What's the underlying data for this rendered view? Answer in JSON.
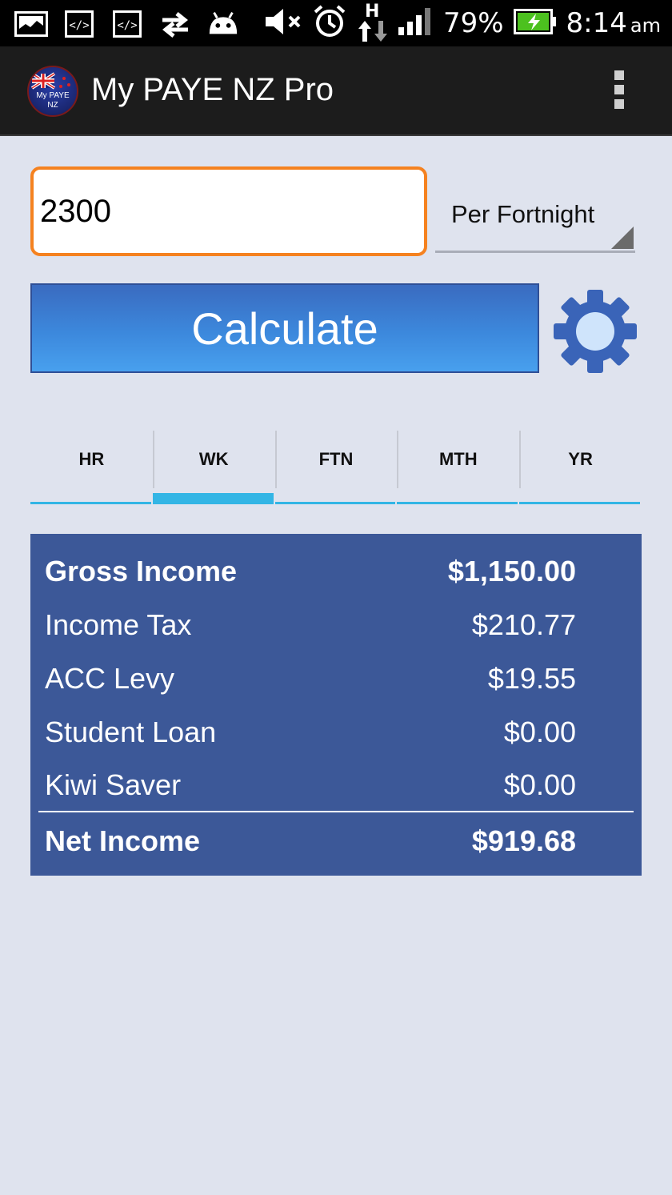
{
  "status_bar": {
    "battery_percent": "79%",
    "time": "8:14",
    "ampm": "am",
    "network_label": "H",
    "icons": [
      "image-icon",
      "code-icon",
      "code-icon",
      "sync-icon",
      "android-icon",
      "mute-icon",
      "alarm-icon",
      "network-h-icon",
      "signal-icon",
      "battery-icon"
    ]
  },
  "action_bar": {
    "title": "My PAYE NZ Pro",
    "logo_text_line1": "My PAYE",
    "logo_text_line2": "NZ"
  },
  "input": {
    "value": "2300"
  },
  "period_select": {
    "selected": "Per Fortnight"
  },
  "calculate_button": {
    "label": "Calculate"
  },
  "tabs": [
    {
      "label": "HR",
      "active": false
    },
    {
      "label": "WK",
      "active": true
    },
    {
      "label": "FTN",
      "active": false
    },
    {
      "label": "MTH",
      "active": false
    },
    {
      "label": "YR",
      "active": false
    }
  ],
  "results": [
    {
      "label": "Gross Income",
      "value": "$1,150.00",
      "bold": true
    },
    {
      "label": "Income Tax",
      "value": "$210.77",
      "bold": false
    },
    {
      "label": "ACC Levy",
      "value": "$19.55",
      "bold": false
    },
    {
      "label": "Student Loan",
      "value": "$0.00",
      "bold": false
    },
    {
      "label": "Kiwi Saver",
      "value": "$0.00",
      "bold": false
    },
    {
      "label": "Net Income",
      "value": "$919.68",
      "bold": true
    }
  ],
  "colors": {
    "background": "#dfe3ee",
    "accent_orange": "#f58220",
    "button_blue": "#3c88dc",
    "tab_indicator": "#33b5e5",
    "results_bg": "#3c5898"
  }
}
